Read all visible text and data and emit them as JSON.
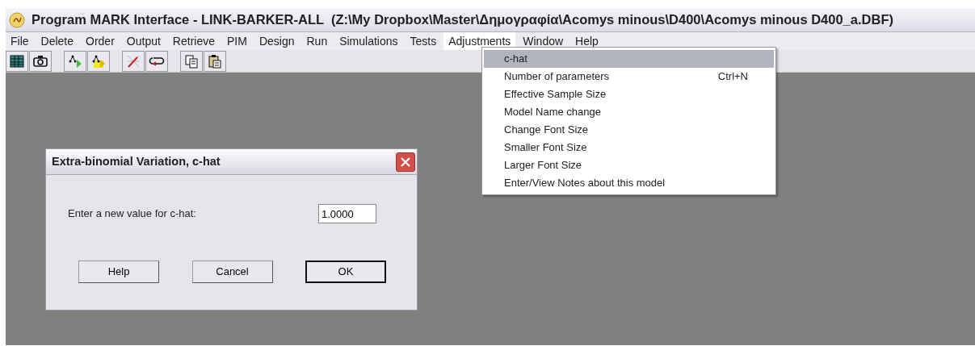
{
  "window": {
    "title": "Program MARK Interface - LINK-BARKER-ALL  (Z:\\My Dropbox\\Master\\Δημογραφία\\Acomys minous\\D400\\Acomys minous D400_a.DBF)"
  },
  "menu_bar": [
    {
      "label": "File",
      "selected": false
    },
    {
      "label": "Delete",
      "selected": false
    },
    {
      "label": "Order",
      "selected": false
    },
    {
      "label": "Output",
      "selected": false
    },
    {
      "label": "Retrieve",
      "selected": false
    },
    {
      "label": "PIM",
      "selected": false
    },
    {
      "label": "Design",
      "selected": false
    },
    {
      "label": "Run",
      "selected": false
    },
    {
      "label": "Simulations",
      "selected": false
    },
    {
      "label": "Tests",
      "selected": false
    },
    {
      "label": "Adjustments",
      "selected": true
    },
    {
      "label": "Window",
      "selected": false
    },
    {
      "label": "Help",
      "selected": false
    }
  ],
  "dropdown_menu": [
    {
      "label": "c-hat",
      "selected": true
    },
    {
      "label": "Number of parameters",
      "shortcut": "Ctrl+N",
      "selected": false
    },
    {
      "label": "Effective Sample Size",
      "selected": false
    },
    {
      "label": "Model Name change",
      "selected": false
    },
    {
      "label": "Change Font Size",
      "selected": false
    },
    {
      "label": "Smaller Font Size",
      "selected": false
    },
    {
      "label": "Larger Font Size",
      "selected": false
    },
    {
      "label": "Enter/View Notes about this model",
      "selected": false
    }
  ],
  "dialog": {
    "title": "Extra-binomial Variation, c-hat",
    "prompt": "Enter a new value for c-hat:",
    "value": "1.0000",
    "buttons": [
      {
        "label": "Help",
        "default": false
      },
      {
        "label": "Cancel",
        "default": false
      },
      {
        "label": "OK",
        "default": true
      }
    ]
  }
}
